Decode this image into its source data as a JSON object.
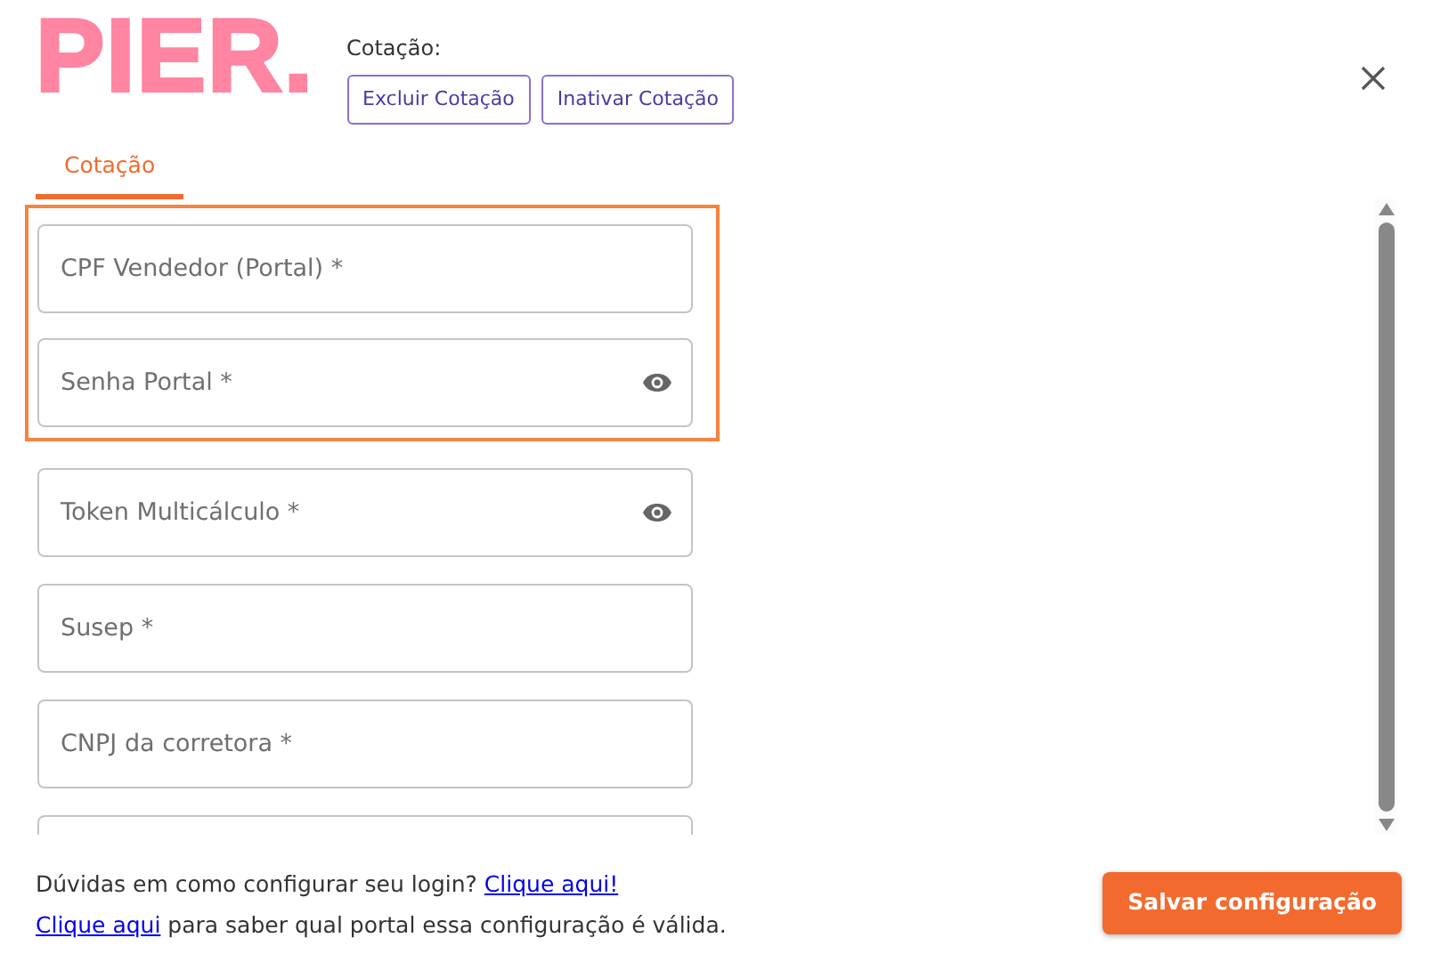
{
  "logo": "PIER.",
  "quote": {
    "label": "Cotação:",
    "buttons": [
      "Excluir Cotação",
      "Inativar Cotação"
    ]
  },
  "tabs": [
    {
      "label": "Cotação",
      "selected": true
    }
  ],
  "highlighted_fields": [
    {
      "kind": "field",
      "label": "CPF Vendedor (Portal) *",
      "reveal": false
    },
    {
      "kind": "field",
      "label": "Senha Portal *",
      "reveal": true
    }
  ],
  "fields": [
    {
      "kind": "field",
      "label": "Token Multicálculo *",
      "reveal": true
    },
    {
      "kind": "field",
      "label": "Susep *",
      "reveal": false
    },
    {
      "kind": "field",
      "label": "CNPJ da corretora *",
      "reveal": false
    },
    {
      "kind": "field"
    }
  ],
  "help": [
    [
      {
        "text": "Dúvidas em como configurar seu login?",
        "link": false
      },
      {
        "text": "Clique aqui!",
        "link": true
      }
    ],
    [
      {
        "text": "Clique aqui",
        "link": true
      },
      {
        "text": "para saber qual portal essa configuração é válida.",
        "link": false
      }
    ]
  ],
  "save_button": "Salvar configuração"
}
